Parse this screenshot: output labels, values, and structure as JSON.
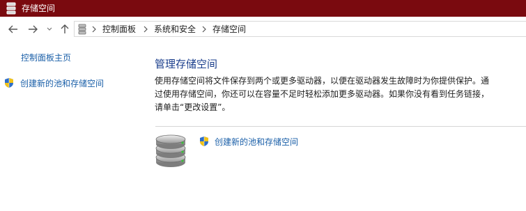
{
  "window": {
    "title": "存储空间"
  },
  "addressbar": {
    "crumbs": [
      "控制面板",
      "系统和安全",
      "存储空间"
    ]
  },
  "sidebar": {
    "home_link": "控制面板主页",
    "create_link": "创建新的池和存储空间"
  },
  "main": {
    "title": "管理存储空间",
    "description_lines": [
      "使用存储空间将文件保存到两个或更多驱动器，以便在驱动器发生故障时为你提供保护。通",
      "过使用存储空间，你还可以在容量不足时轻松添加更多驱动器。如果你没有看到任务链接，",
      "请单击“更改设置”。"
    ],
    "action_link": "创建新的池和存储空间"
  },
  "colors": {
    "titlebar_bg": "#7a0a0f",
    "link": "#1a5fa8",
    "heading": "#1a3e8c"
  },
  "icons": {
    "app": "storage-spaces-icon",
    "back": "back-arrow-icon",
    "forward": "forward-arrow-icon",
    "recent": "chevron-down-icon",
    "up": "up-arrow-icon",
    "shield": "uac-shield-icon"
  }
}
